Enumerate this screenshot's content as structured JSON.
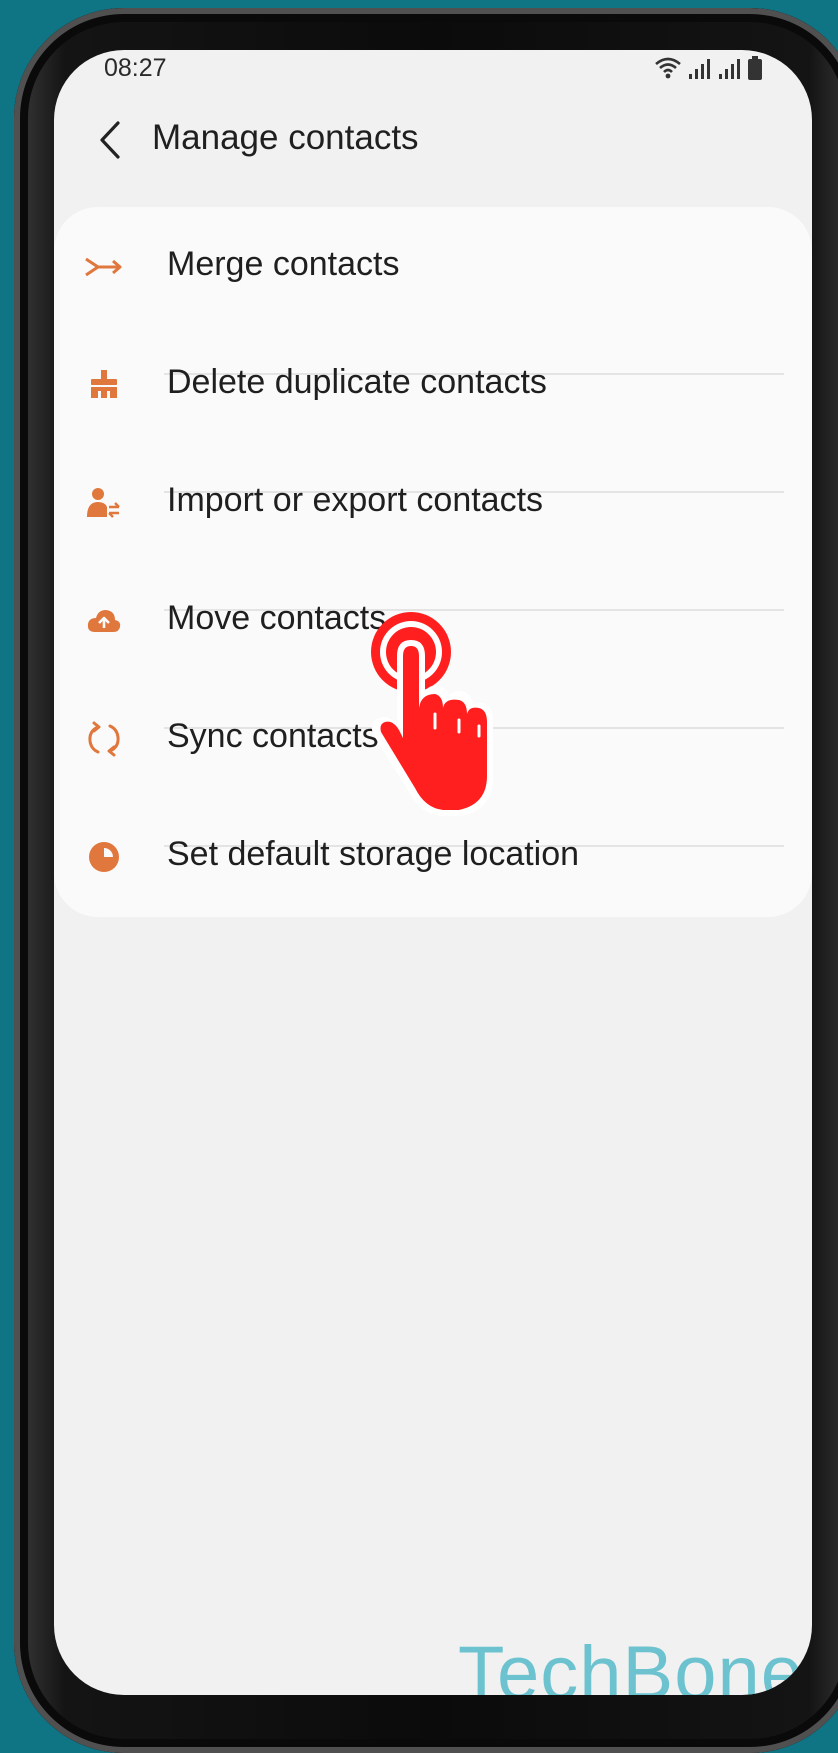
{
  "status_bar": {
    "time": "08:27"
  },
  "header": {
    "title": "Manage contacts",
    "back_icon": "chevron-left-icon"
  },
  "menu": {
    "items": [
      {
        "label": "Merge contacts",
        "icon": "merge-icon"
      },
      {
        "label": "Delete duplicate contacts",
        "icon": "broom-icon"
      },
      {
        "label": "Import or export contacts",
        "icon": "person-transfer-icon"
      },
      {
        "label": "Move contacts",
        "icon": "cloud-upload-icon"
      },
      {
        "label": "Sync contacts",
        "icon": "sync-icon"
      },
      {
        "label": "Set default storage location",
        "icon": "pie-storage-icon"
      }
    ]
  },
  "overlay": {
    "icon": "tap-hand-icon"
  },
  "watermark": {
    "text": "TechBone"
  },
  "colors": {
    "accent": "#e0773c",
    "tap_hand": "#ff1f1f",
    "watermark": "#6cc3cf",
    "background": "#0f7484"
  }
}
